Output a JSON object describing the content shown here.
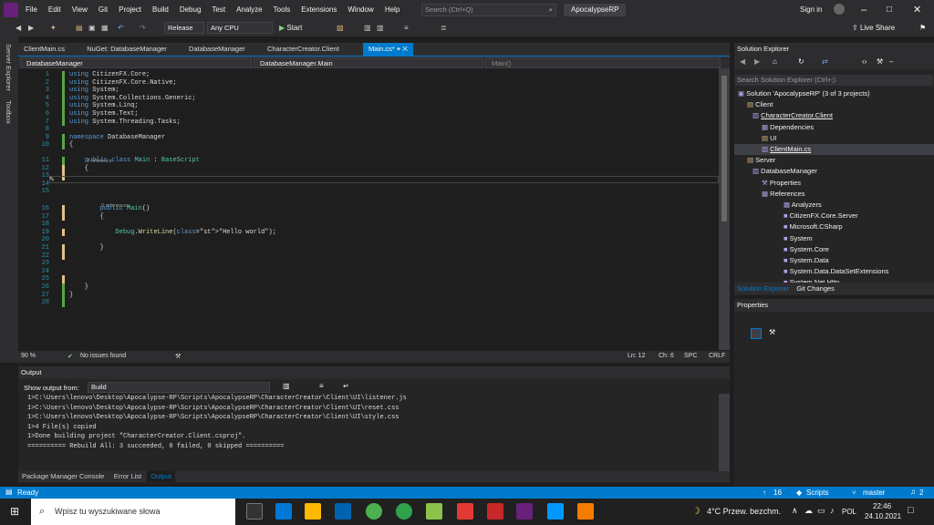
{
  "menu": [
    "File",
    "Edit",
    "View",
    "Git",
    "Project",
    "Build",
    "Debug",
    "Test",
    "Analyze",
    "Tools",
    "Extensions",
    "Window",
    "Help"
  ],
  "search_placeholder": "Search (Ctrl+Q)",
  "solution_name": "ApocalypseRP",
  "sign_in": "Sign in",
  "live_share": "Live Share",
  "toolbar": {
    "config": "Release",
    "platform": "Any CPU",
    "start": "Start"
  },
  "rail": {
    "server_explorer": "Server Explorer",
    "toolbox": "Toolbox"
  },
  "tabs": [
    "ClientMain.cs",
    "NuGet: DatabaseManager",
    "DatabaseManager",
    "CharacterCreator.Client",
    "Main.cs*"
  ],
  "nav": {
    "project": "DatabaseManager",
    "type": "DatabaseManager.Main",
    "member": "Main()"
  },
  "code_lines": [
    {
      "n": "1",
      "t": "using CitizenFX.Core;"
    },
    {
      "n": "2",
      "t": "using CitizenFX.Core.Native;"
    },
    {
      "n": "3",
      "t": "using System;"
    },
    {
      "n": "4",
      "t": "using System.Collections.Generic;"
    },
    {
      "n": "5",
      "t": "using System.Linq;"
    },
    {
      "n": "6",
      "t": "using System.Text;"
    },
    {
      "n": "7",
      "t": "using System.Threading.Tasks;"
    },
    {
      "n": "8",
      "t": ""
    },
    {
      "n": "9",
      "t": "namespace DatabaseManager"
    },
    {
      "n": "10",
      "t": "{"
    },
    {
      "n": "11",
      "t": "    public class Main : BaseScript"
    },
    {
      "n": "12",
      "t": "    {"
    },
    {
      "n": "13",
      "t": ""
    },
    {
      "n": "14",
      "t": ""
    },
    {
      "n": "15",
      "t": ""
    },
    {
      "n": "16",
      "t": "        public Main()"
    },
    {
      "n": "17",
      "t": "        {"
    },
    {
      "n": "18",
      "t": ""
    },
    {
      "n": "19",
      "t": "            Debug.WriteLine(\"Hello world\");"
    },
    {
      "n": "20",
      "t": ""
    },
    {
      "n": "21",
      "t": "        }"
    },
    {
      "n": "22",
      "t": ""
    },
    {
      "n": "23",
      "t": ""
    },
    {
      "n": "24",
      "t": ""
    },
    {
      "n": "25",
      "t": ""
    },
    {
      "n": "26",
      "t": "    }"
    },
    {
      "n": "27",
      "t": "}"
    },
    {
      "n": "28",
      "t": ""
    }
  ],
  "refs": {
    "class_ref": "1 reference",
    "ctor_ref": "0 references"
  },
  "editor_status": {
    "zoom": "90 %",
    "issues": "No issues found",
    "ln": "Ln: 12",
    "ch": "Ch: 6",
    "spc": "SPC",
    "crlf": "CRLF"
  },
  "solution_explorer": {
    "title": "Solution Explorer",
    "search": "Search Solution Explorer (Ctrl+;)",
    "items": [
      "Solution 'ApocalypseRP' (3 of 3 projects)",
      "Client",
      "CharacterCreator.Client",
      "Dependencies",
      "UI",
      "ClientMain.cs",
      "Server",
      "DatabaseManager",
      "Properties",
      "References",
      "Analyzers",
      "CitizenFX.Core.Server",
      "Microsoft.CSharp",
      "System",
      "System.Core",
      "System.Data",
      "System.Data.DataSetExtensions",
      "System.Net.Http"
    ],
    "tabs": [
      "Solution Explorer",
      "Git Changes"
    ]
  },
  "properties_title": "Properties",
  "output": {
    "title": "Output",
    "show_from": "Show output from:",
    "source": "Build",
    "lines": [
      "1>C:\\Users\\lenovo\\Desktop\\Apocalypse-RP\\Scripts\\ApocalypseRP\\CharacterCreator\\Client\\UI\\listener.js",
      "1>C:\\Users\\lenovo\\Desktop\\Apocalypse-RP\\Scripts\\ApocalypseRP\\CharacterCreator\\Client\\UI\\reset.css",
      "1>C:\\Users\\lenovo\\Desktop\\Apocalypse-RP\\Scripts\\ApocalypseRP\\CharacterCreator\\Client\\UI\\style.css",
      "1>4 File(s) copied",
      "1>Done building project \"CharacterCreator.Client.csproj\".",
      "========== Rebuild All: 3 succeeded, 0 failed, 0 skipped =========="
    ],
    "tabs": [
      "Package Manager Console",
      "Error List",
      "Output"
    ]
  },
  "statusbar": {
    "ready": "Ready",
    "up": "16",
    "branch_repo": "Scripts",
    "branch": "master",
    "notif": "2"
  },
  "taskbar": {
    "search": "Wpisz tu wyszukiwane słowa",
    "weather": "4°C  Przew. bezchm.",
    "lang": "POL",
    "time": "22:46",
    "date": "24.10.2021"
  },
  "colors": {
    "accent": "#007acc",
    "keyword": "#569cd6",
    "type": "#4ec9b0",
    "string": "#d69d85",
    "linenum": "#2b91af"
  }
}
